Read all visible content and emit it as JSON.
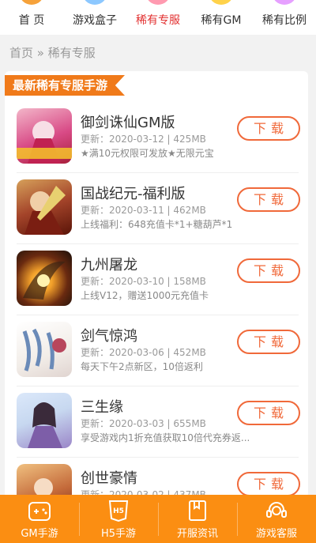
{
  "topnav": {
    "items": [
      {
        "label": "首 页",
        "color": "#f6a23a"
      },
      {
        "label": "游戏盒子",
        "color": "#8cc8ff"
      },
      {
        "label": "稀有专服",
        "color": "#ff9ab0",
        "active": true
      },
      {
        "label": "稀有GM",
        "color": "#ffd24a"
      },
      {
        "label": "稀有比例",
        "color": "#e6a0ff"
      }
    ]
  },
  "breadcrumb": {
    "home": "首页",
    "sep": "»",
    "current": "稀有专服"
  },
  "section": {
    "title": "最新稀有专服手游"
  },
  "games": [
    {
      "name": "御剑诛仙GM版",
      "meta": "更新：2020-03-12 | 425MB",
      "desc": "★满10元权限可发放★无限元宝",
      "download": "下载",
      "icon": "game-yujian-icon",
      "colors": [
        "#d84a86",
        "#f3b6c9"
      ]
    },
    {
      "name": "国战纪元-福利版",
      "meta": "更新：2020-03-11 | 462MB",
      "desc": "上线福利：648充值卡*1+糖葫芦*1",
      "download": "下载",
      "icon": "game-guozhan-icon",
      "colors": [
        "#7a1e12",
        "#d6a05a"
      ]
    },
    {
      "name": "九州屠龙",
      "meta": "更新：2020-03-10 | 158MB",
      "desc": "上线V12，赠送1000元充值卡",
      "download": "下载",
      "icon": "game-jiuzhou-icon",
      "colors": [
        "#2a1a10",
        "#f2a02a"
      ]
    },
    {
      "name": "剑气惊鸿",
      "meta": "更新：2020-03-06 | 452MB",
      "desc": "每天下午2点新区，10倍返利",
      "download": "下载",
      "icon": "game-jianqi-icon",
      "colors": [
        "#f2ede8",
        "#b8465c"
      ]
    },
    {
      "name": "三生缘",
      "meta": "更新：2020-03-03 | 655MB",
      "desc": "享受游戏内1折充值获取10倍代充券返...",
      "download": "下载",
      "icon": "game-sanshengyuan-icon",
      "colors": [
        "#c7d8f0",
        "#7d5ea8"
      ]
    },
    {
      "name": "创世豪情",
      "meta": "更新：2020-03-02 | 437MB",
      "desc": "",
      "download": "下载",
      "icon": "game-chuangshi-icon",
      "colors": [
        "#a4442a",
        "#f0c080"
      ]
    }
  ],
  "bottombar": {
    "tabs": [
      {
        "label": "GM手游",
        "icon": "gamepad-icon"
      },
      {
        "label": "H5手游",
        "icon": "h5-icon"
      },
      {
        "label": "开服资讯",
        "icon": "news-icon"
      },
      {
        "label": "游戏客服",
        "icon": "support-icon"
      }
    ]
  },
  "colors": {
    "accent": "#fb8e12",
    "download": "#f0693a",
    "active_nav": "#e23030"
  }
}
